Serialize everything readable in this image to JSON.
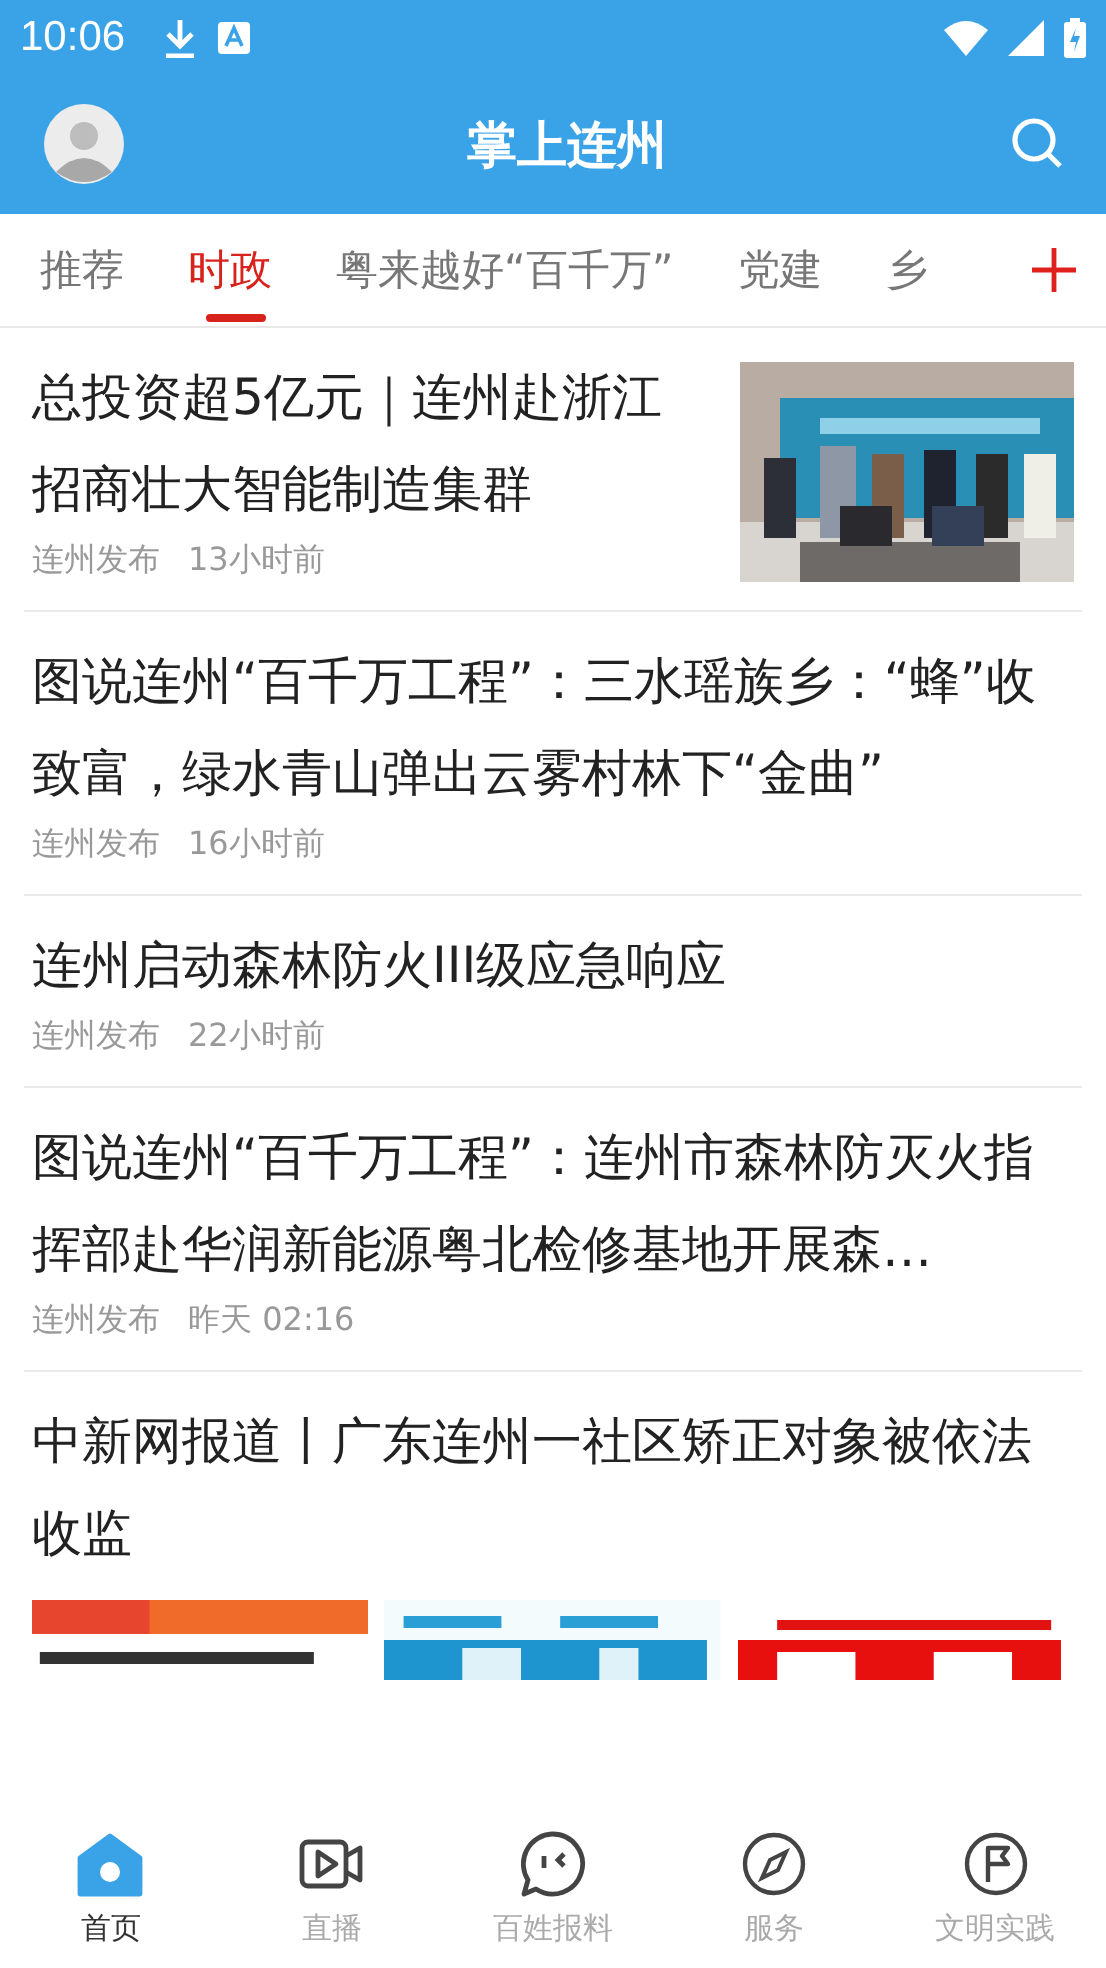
{
  "status_bar": {
    "time": "10:06"
  },
  "header": {
    "title": "掌上连州"
  },
  "tabs": [
    {
      "label": "推荐",
      "selected": false
    },
    {
      "label": "时政",
      "selected": true
    },
    {
      "label": "粤来越好“百千万”",
      "selected": false
    },
    {
      "label": "党建",
      "selected": false
    },
    {
      "label": "乡",
      "selected": false
    }
  ],
  "articles": [
    {
      "kind": "thumb",
      "title": "总投资超5亿元｜连州赴浙江招商壮大智能制造集群",
      "source": "连州发布",
      "time": "13小时前"
    },
    {
      "kind": "text",
      "title": "图说连州“百千万工程”：三水瑶族乡：“蜂”收致富，绿水青山弹出云雾村林下“金曲”",
      "source": "连州发布",
      "time": "16小时前"
    },
    {
      "kind": "text",
      "title": "连州启动森林防火III级应急响应",
      "source": "连州发布",
      "time": "22小时前"
    },
    {
      "kind": "text",
      "title": "图说连州“百千万工程”：连州市森林防灭火指挥部赴华润新能源粤北检修基地开展森…",
      "source": "连州发布",
      "time": "昨天 02:16"
    },
    {
      "kind": "gallery",
      "title": "中新网报道丨广东连州一社区矫正对象被依法收监"
    }
  ],
  "nav": [
    {
      "label": "首页",
      "kind": "home",
      "selected": true
    },
    {
      "label": "直播",
      "kind": "video",
      "selected": false
    },
    {
      "label": "百姓报料",
      "kind": "chat",
      "selected": false
    },
    {
      "label": "服务",
      "kind": "compass",
      "selected": false
    },
    {
      "label": "文明实践",
      "kind": "flag",
      "selected": false
    }
  ]
}
